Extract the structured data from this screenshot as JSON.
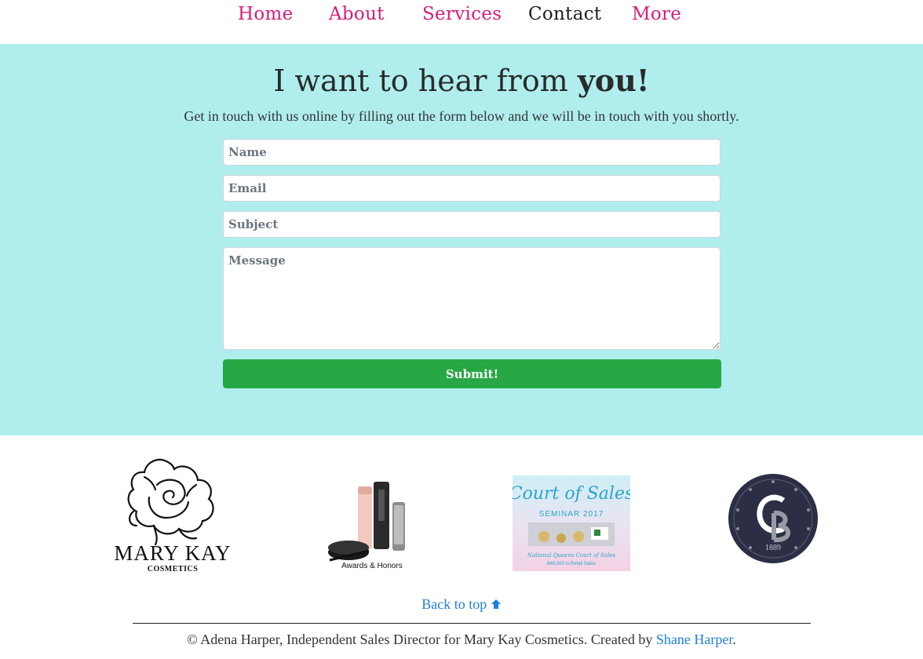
{
  "nav": {
    "items": [
      {
        "label": "Home"
      },
      {
        "label": "About"
      },
      {
        "label": "Services"
      },
      {
        "label": "Contact"
      },
      {
        "label": "More"
      }
    ],
    "active": "Contact"
  },
  "contact": {
    "heading_main": "I want to hear from ",
    "heading_bold": "you!",
    "subtitle": "Get in touch with us online by filling out the form below and we will be in touch with you shortly.",
    "name_placeholder": "Name",
    "email_placeholder": "Email",
    "subject_placeholder": "Subject",
    "message_placeholder": "Message",
    "submit_label": "Submit!"
  },
  "logos": {
    "marykay_name": "MARY KAY",
    "marykay_sub": "COSMETICS",
    "awards_caption": "Awards & Honors",
    "court_title": "Court of Sales",
    "court_seminar": "SEMINAR 2017",
    "court_line1": "National Queens Court of Sales",
    "court_line2": "$40,000 in Retail Sales",
    "cb_year": "1889"
  },
  "footer": {
    "back_to_top": "Back to top",
    "copyright": "© Adena Harper, Independent Sales Director for Mary Kay Cosmetics. Created by ",
    "creator_link": "Shane Harper",
    "period": "."
  }
}
